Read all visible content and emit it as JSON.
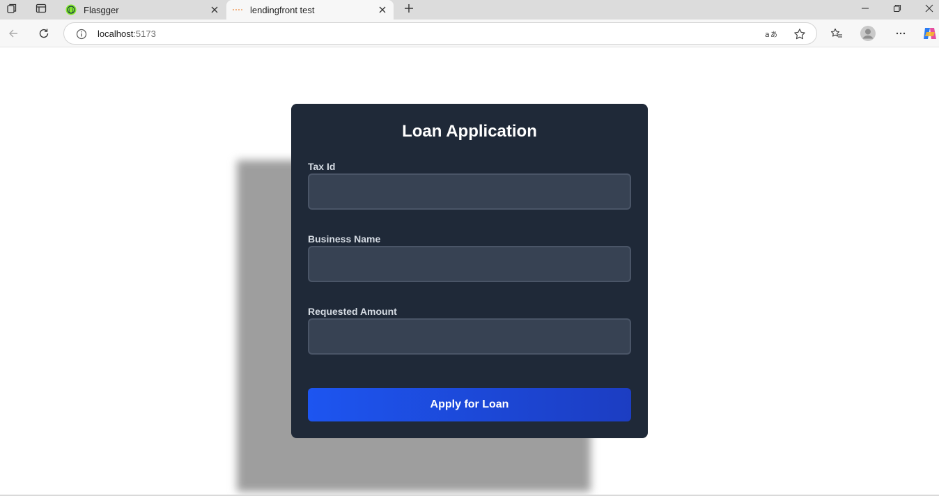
{
  "browser": {
    "tabs": [
      {
        "title": "Flasgger",
        "favicon": "flasgger-icon",
        "active": false
      },
      {
        "title": "lendingfront test",
        "favicon": "loading-icon",
        "active": true
      }
    ],
    "address": {
      "host": "localhost",
      "port": ":5173"
    },
    "icons": {
      "workspaces": "workspaces-icon",
      "tab_actions": "tab-actions-icon",
      "new_tab": "plus-icon",
      "minimize": "minimize-icon",
      "restore": "restore-icon",
      "close": "close-icon",
      "back": "back-arrow-icon",
      "reload": "reload-icon",
      "info": "info-icon",
      "read_aloud": "read-aloud-icon",
      "favorite": "star-icon",
      "favorites": "favorites-icon",
      "profile": "profile-icon",
      "more": "more-icon",
      "copilot": "copilot-icon"
    },
    "accent": "#1d55f0"
  },
  "form": {
    "title": "Loan Application",
    "fields": [
      {
        "label": "Tax Id",
        "value": ""
      },
      {
        "label": "Business Name",
        "value": ""
      },
      {
        "label": "Requested Amount",
        "value": ""
      }
    ],
    "submit_label": "Apply for Loan"
  }
}
